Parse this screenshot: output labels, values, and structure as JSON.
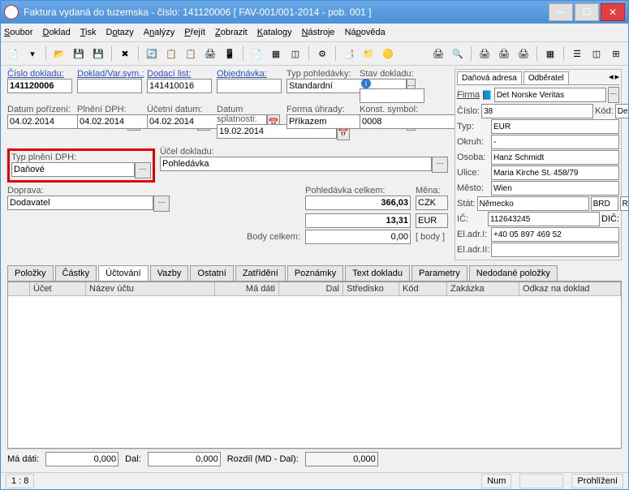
{
  "title": "Faktura vydaná do tuzemska - číslo: 141120006  [ FAV-001/001-2014 - pob. 001 ]",
  "menu": [
    "Soubor",
    "Doklad",
    "Tisk",
    "Dotazy",
    "Analýzy",
    "Přejít",
    "Zobrazit",
    "Katalogy",
    "Nástroje",
    "Nápověda"
  ],
  "labels": {
    "cislo_dokladu": "Číslo dokladu:",
    "doklad_varsym": "Doklad/Var.sym.:",
    "dodaci_list": "Dodací list:",
    "objednavka": "Objednávka:",
    "typ_pohledavky": "Typ pohledávky:",
    "stav_dokladu": "Stav dokladu:",
    "datum_porizeni": "Datum pořízení:",
    "plneni_dph": "Plnění DPH:",
    "ucetni_datum": "Účetní datum:",
    "datum_splatnosti": "Datum splatnosti:",
    "forma_uhrady": "Forma úhrady:",
    "konst_symbol": "Konst. symbol:",
    "typ_plneni_dph": "Typ plnění DPH:",
    "ucel_dokladu": "Účel dokladu:",
    "doprava": "Doprava:",
    "pohledavka_celkem": "Pohledávka celkem:",
    "mena": "Měna:",
    "body_celkem": "Body celkem:",
    "body_unit": "[ body ]",
    "ma_dati": "Má dáti:",
    "dal": "Dal:",
    "rozdil": "Rozdíl (MD - Dal):"
  },
  "values": {
    "cislo_dokladu": "141120006",
    "doklad_varsym": "",
    "dodaci_list": "141410016",
    "objednavka": "",
    "typ_pohledavky": "Standardní",
    "stav_dokladu": "",
    "datum_porizeni": "04.02.2014",
    "plneni_dph": "04.02.2014",
    "ucetni_datum": "04.02.2014",
    "datum_splatnosti": "19.02.2014",
    "forma_uhrady": "Příkazem",
    "konst_symbol": "0008",
    "typ_plneni_dph": "Daňové",
    "ucel_dokladu": "Pohledávka",
    "doprava": "Dodavatel",
    "pohledavka_czk": "366,03",
    "mena_czk": "CZK",
    "pohledavka_eur": "13,31",
    "mena_eur": "EUR",
    "body_celkem": "0,00",
    "ma_dati": "0,000",
    "dal": "0,000",
    "rozdil": "0,000"
  },
  "bottom_tabs": [
    "Položky",
    "Částky",
    "Účtování",
    "Vazby",
    "Ostatní",
    "Zatřídění",
    "Poznámky",
    "Text dokladu",
    "Parametry",
    "Nedodané položky"
  ],
  "grid_cols": [
    "",
    "Účet",
    "Název účtu",
    "Má dáti",
    "Dal",
    "Středisko",
    "Kód",
    "Zakázka",
    "Odkaz na doklad"
  ],
  "addr": {
    "tabs": [
      "Daňová adresa",
      "Odběratel"
    ],
    "firma_label": "Firma",
    "firma": "Det Norske Veritas",
    "cislo_label": "Číslo:",
    "cislo": "38",
    "kod_label": "Kód:",
    "kod": "De",
    "typ_label": "Typ:",
    "typ": "EUR",
    "okruh_label": "Okruh:",
    "okruh": "-",
    "osoba_label": "Osoba:",
    "osoba": "Hanz Schmidt",
    "ulice_label": "Ulice:",
    "ulice": "Maria Kirche St. 458/79",
    "mesto_label": "Město:",
    "mesto": "Wien",
    "stat_label": "Stát:",
    "stat": "Německo",
    "stat_kod": "BRD",
    "stat_r": "R",
    "ic_label": "IČ:",
    "ic": "112643245",
    "dic_label": "DIČ:",
    "eladr1_label": "El.adr.I:",
    "eladr1": "+40 05 897 469 52",
    "eladr2_label": "El.adr.II:",
    "eladr2": ""
  },
  "status": {
    "pos": "1 :   8",
    "num": "Num",
    "mode": "Prohlížení"
  }
}
